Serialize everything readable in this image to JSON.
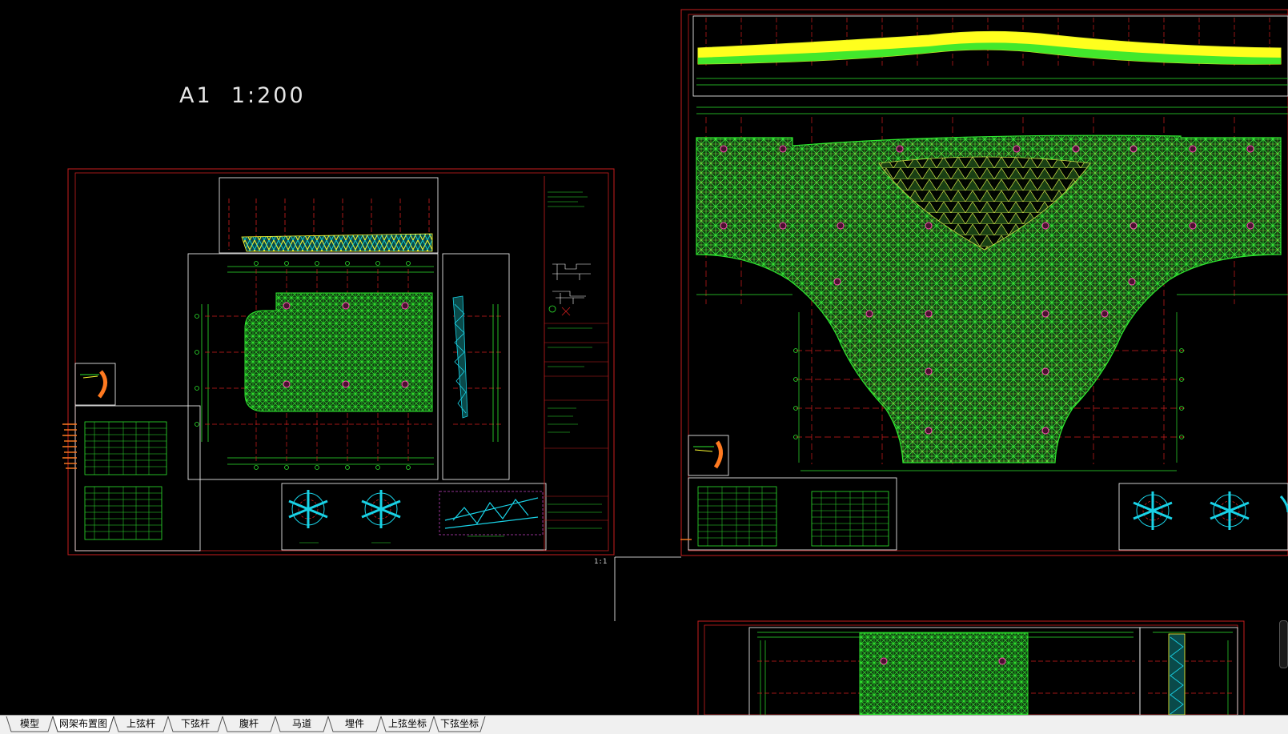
{
  "drawing": {
    "scale_label": "A1  1:200",
    "ratio_label": "1:1"
  },
  "colors": {
    "background": "#000000",
    "frame": "#c81e1e",
    "member": "#2ee62e",
    "highlight": "#ffff00",
    "node": "#ff4fb4",
    "axis_dash": "#d21e1e",
    "detail": "#19d2e6",
    "text": "#e6e6e6"
  },
  "tabs": [
    {
      "label": "模型",
      "active": false
    },
    {
      "label": "网架布置图",
      "active": true
    },
    {
      "label": "上弦杆",
      "active": false
    },
    {
      "label": "下弦杆",
      "active": false
    },
    {
      "label": "腹杆",
      "active": false
    },
    {
      "label": "马道",
      "active": false
    },
    {
      "label": "埋件",
      "active": false
    },
    {
      "label": "上弦坐标",
      "active": false
    },
    {
      "label": "下弦坐标",
      "active": false
    }
  ],
  "icons": {
    "scroll": "scrollbar-thumb-icon",
    "cursor": "cursor-arrow-icon"
  }
}
